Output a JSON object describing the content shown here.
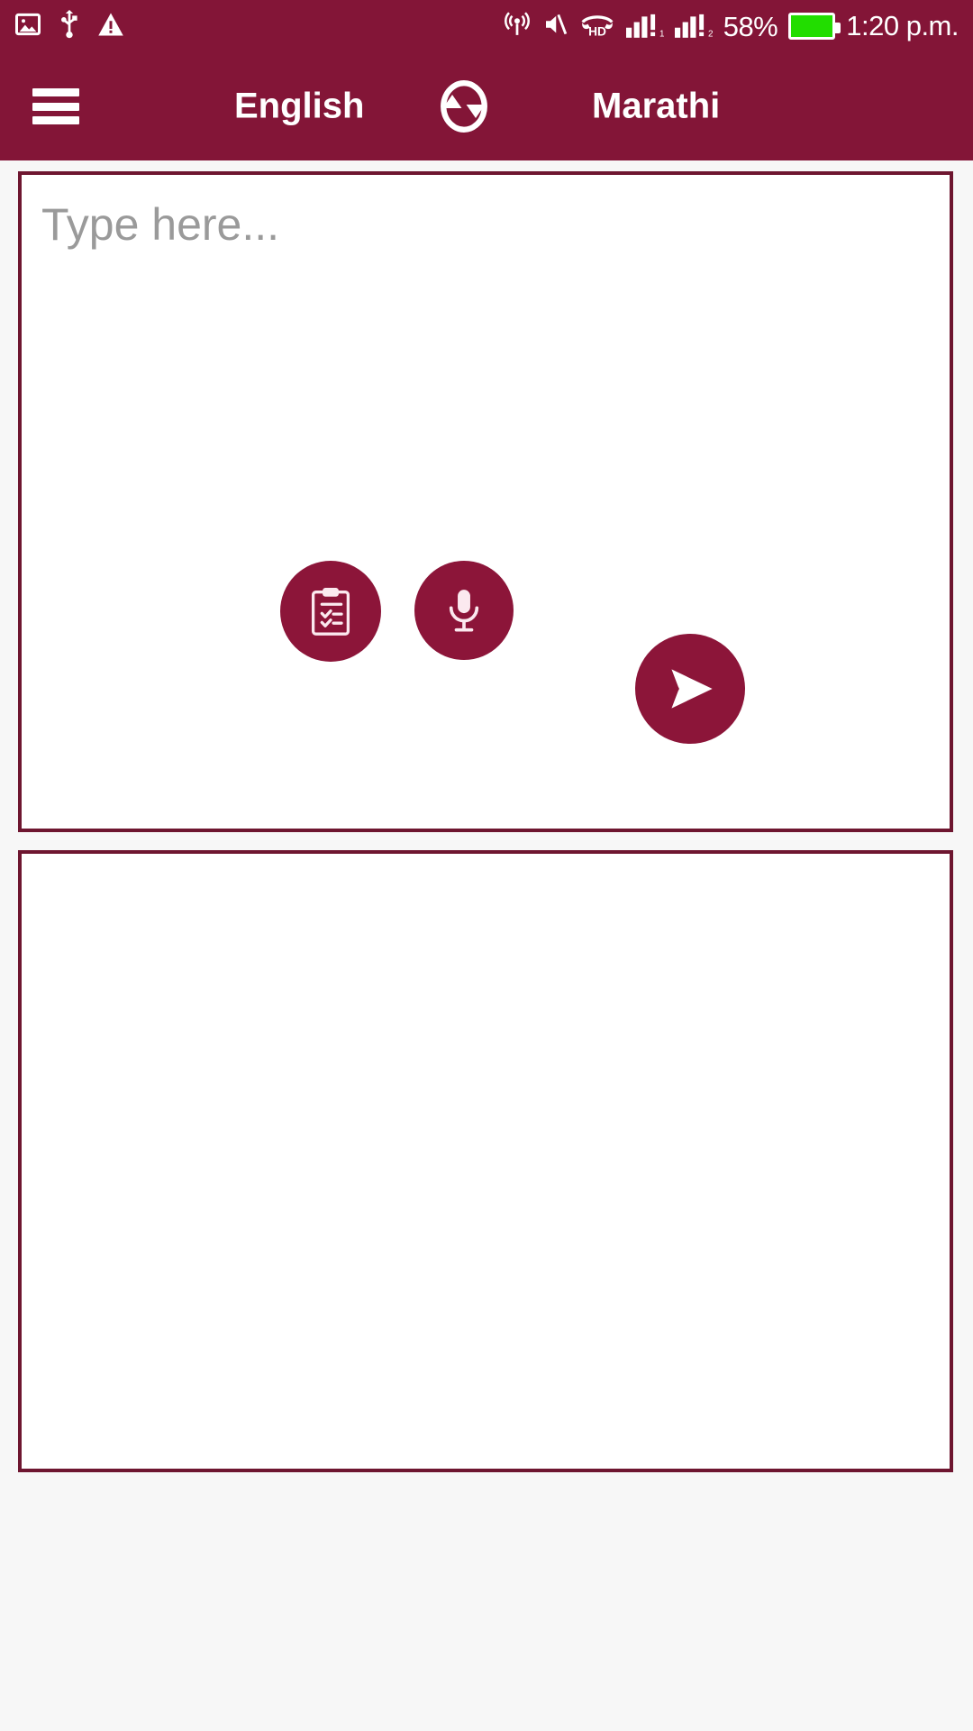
{
  "theme": {
    "primary": "#831537",
    "panel_border": "#6e1630",
    "fab": "#8c1539",
    "background": "#f7f7f7",
    "placeholder_text": "#9a9a9a",
    "battery_fill": "#22dd00",
    "status_text": "#ffffff"
  },
  "status_bar": {
    "left_icons": [
      {
        "name": "image-icon",
        "label": "Screenshot"
      },
      {
        "name": "usb-icon",
        "label": "USB"
      },
      {
        "name": "warning-icon",
        "label": "Warning"
      }
    ],
    "right_icons": [
      {
        "name": "hotspot-icon",
        "label": "Hotspot"
      },
      {
        "name": "mute-icon",
        "label": "Silent"
      },
      {
        "name": "hd-call-icon",
        "label": "HD"
      },
      {
        "name": "signal-sim1-icon",
        "label": "Signal SIM 1"
      },
      {
        "name": "signal-sim2-icon",
        "label": "Signal SIM 2"
      }
    ],
    "battery_percent": "58%",
    "time": "1:20 p.m."
  },
  "app_bar": {
    "menu_label": "Menu",
    "source_language": "English",
    "target_language": "Marathi",
    "swap_label": "Swap languages"
  },
  "input_panel": {
    "placeholder": "Type here...",
    "value": "",
    "actions": [
      {
        "name": "clipboard-button",
        "label": "Paste from clipboard"
      },
      {
        "name": "mic-button",
        "label": "Voice input"
      }
    ]
  },
  "send_button": {
    "label": "Translate"
  },
  "output_panel": {
    "value": ""
  }
}
